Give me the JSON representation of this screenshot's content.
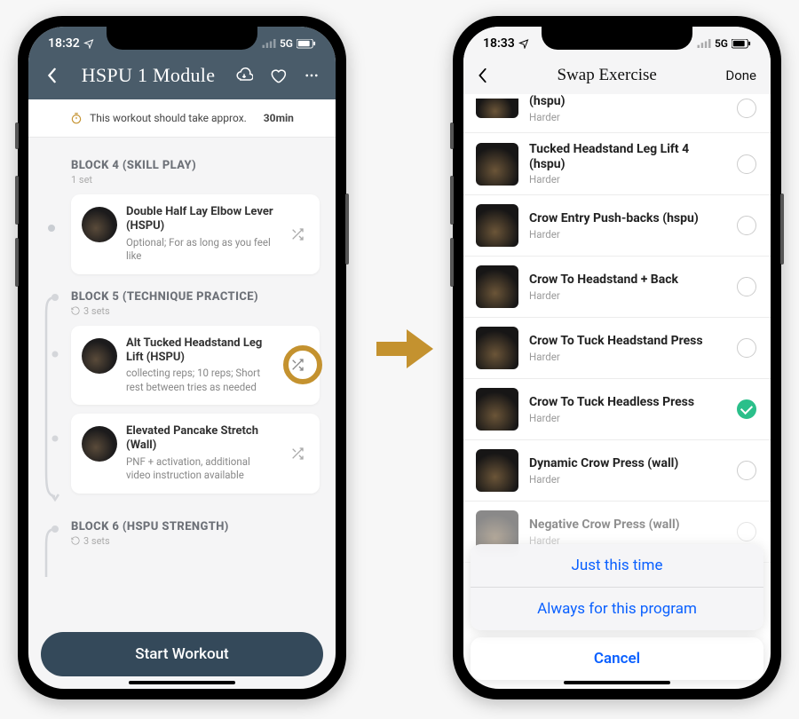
{
  "left": {
    "status": {
      "time": "18:32",
      "net": "5G"
    },
    "header": {
      "title": "HSPU 1 Module"
    },
    "duration": {
      "prefix": "This workout should take approx.",
      "value": "30min"
    },
    "blocks": [
      {
        "title": "BLOCK 4 (SKILL PLAY)",
        "sets": "1 set",
        "exercises": [
          {
            "title": "Double Half Lay Elbow Lever (HSPU)",
            "desc": "Optional; For as long as you feel like"
          }
        ]
      },
      {
        "title": "BLOCK 5 (TECHNIQUE PRACTICE)",
        "sets": "3 sets",
        "exercises": [
          {
            "title": "Alt Tucked Headstand Leg Lift (HSPU)",
            "desc": "collecting reps; 10 reps; Short rest between tries as needed"
          },
          {
            "title": "Elevated Pancake Stretch (Wall)",
            "desc": "PNF + activation, additional video instruction available"
          }
        ]
      },
      {
        "title": "BLOCK 6 (HSPU STRENGTH)",
        "sets": "3 sets",
        "exercises": []
      }
    ],
    "startLabel": "Start Workout"
  },
  "right": {
    "status": {
      "time": "18:33",
      "net": "5G"
    },
    "header": {
      "title": "Swap Exercise",
      "done": "Done"
    },
    "items": [
      {
        "title": "(hspu)",
        "sub": "Harder",
        "selected": false,
        "clip": "top"
      },
      {
        "title": "Tucked Headstand Leg Lift 4 (hspu)",
        "sub": "Harder",
        "selected": false
      },
      {
        "title": "Crow Entry Push-backs (hspu)",
        "sub": "Harder",
        "selected": false
      },
      {
        "title": "Crow To Headstand + Back",
        "sub": "Harder",
        "selected": false
      },
      {
        "title": "Crow To Tuck Headstand Press",
        "sub": "Harder",
        "selected": false
      },
      {
        "title": "Crow To Tuck Headless Press",
        "sub": "Harder",
        "selected": true
      },
      {
        "title": "Dynamic Crow Press (wall)",
        "sub": "Harder",
        "selected": false
      },
      {
        "title": "Negative Crow Press (wall)",
        "sub": "Harder",
        "selected": false,
        "clip": "bot"
      }
    ],
    "sheet": {
      "opt1": "Just this time",
      "opt2": "Always for this program",
      "cancel": "Cancel"
    }
  }
}
